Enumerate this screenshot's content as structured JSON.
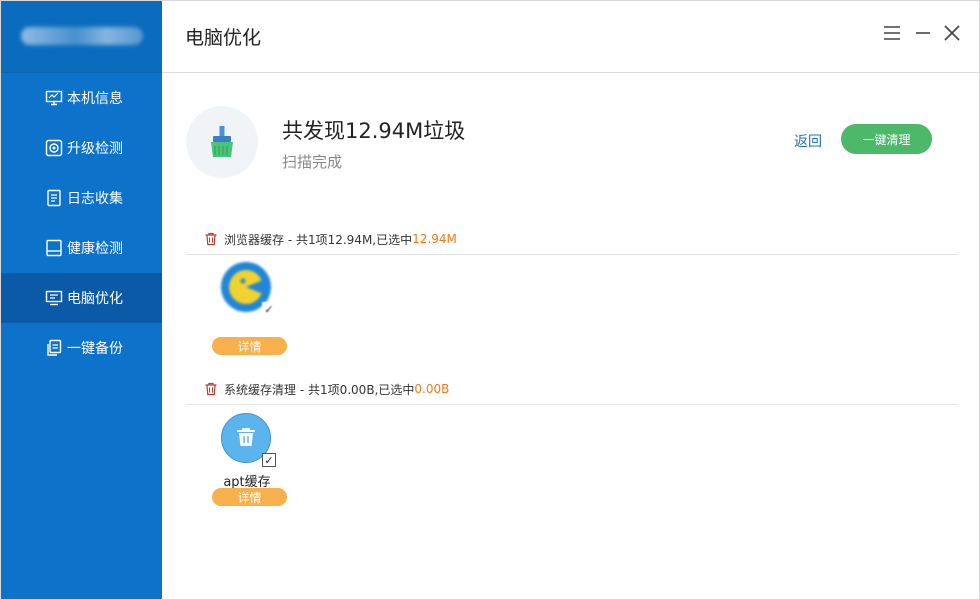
{
  "sidebar": {
    "items": [
      {
        "label": "本机信息",
        "icon": "monitor-icon"
      },
      {
        "label": "升级检测",
        "icon": "target-icon"
      },
      {
        "label": "日志收集",
        "icon": "document-icon"
      },
      {
        "label": "健康检测",
        "icon": "screen-icon"
      },
      {
        "label": "电脑优化",
        "icon": "display-icon",
        "active": true
      },
      {
        "label": "一键备份",
        "icon": "copy-icon"
      }
    ]
  },
  "header": {
    "title": "电脑优化"
  },
  "summary": {
    "title": "共发现12.94M垃圾",
    "subtitle": "扫描完成",
    "back_label": "返回",
    "clean_label": "一键清理"
  },
  "sections": [
    {
      "text": "浏览器缓存 - 共1项12.94M,已选中",
      "highlight": "12.94M",
      "items": [
        {
          "label": "",
          "detail_label": "详情",
          "icon": "browser-app-icon"
        }
      ]
    },
    {
      "text": "系统缓存清理 - 共1项0.00B,已选中",
      "highlight": "0.00B",
      "items": [
        {
          "label": "apt缓存",
          "detail_label": "详情",
          "icon": "trash-can-icon",
          "check": "✓"
        }
      ]
    }
  ],
  "colors": {
    "sidebar": "#0d72c9",
    "sidebar_active": "#0a5aa8",
    "accent_green": "#4cb86a",
    "detail_orange": "#f7b04c",
    "highlight_orange": "#f07a1a",
    "link_blue": "#1f6fc0"
  }
}
